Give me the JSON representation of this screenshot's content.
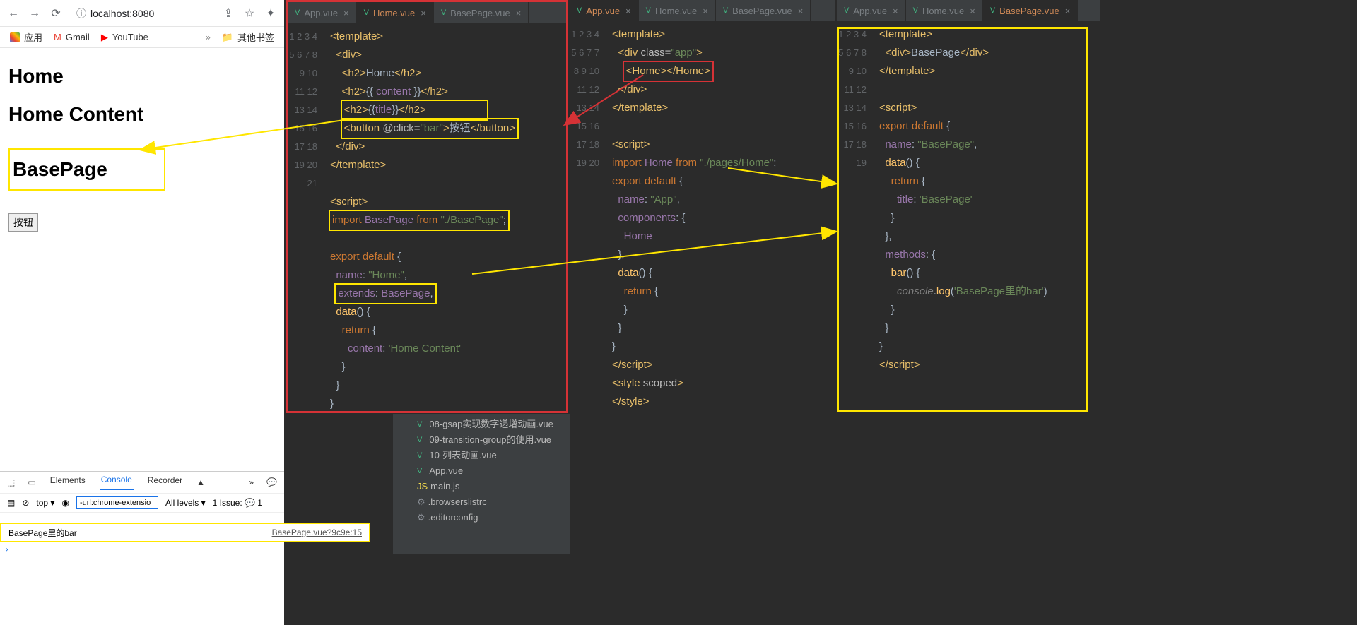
{
  "browser": {
    "url": "localhost:8080",
    "bookmarks_label": "应用",
    "gmail": "Gmail",
    "youtube": "YouTube",
    "others": "其他书签",
    "h1a": "Home",
    "h1b": "Home Content",
    "h1c": "BasePage",
    "button": "按钮"
  },
  "devtools": {
    "tabs": {
      "elements": "Elements",
      "console": "Console",
      "recorder": "Recorder"
    },
    "top": "top",
    "filter": "-url:chrome-extensio",
    "levels": "All levels",
    "issue": "1 Issue:",
    "log_msg": "BasePage里的bar",
    "log_src": "BasePage.vue?9c9e:15"
  },
  "tabs_common": {
    "app": "App.vue",
    "home": "Home.vue",
    "base": "BasePage.vue"
  },
  "editor1_lines": [
    {
      "n": 1,
      "html": "<span class='tag'>&lt;template&gt;</span>"
    },
    {
      "n": 2,
      "html": "  <span class='tag'>&lt;div&gt;</span>"
    },
    {
      "n": 3,
      "html": "    <span class='tag'>&lt;h2&gt;</span>Home<span class='tag'>&lt;/h2&gt;</span>"
    },
    {
      "n": 4,
      "html": "    <span class='tag'>&lt;h2&gt;</span>{{ <span class='id'>content</span> }}<span class='tag'>&lt;/h2&gt;</span>"
    },
    {
      "n": 5,
      "html": "    <span class='hl-yel'><span class='tag'>&lt;h2&gt;</span>{{<span class='id'>title</span>}}<span class='tag'>&lt;/h2&gt;</span>                    </span>"
    },
    {
      "n": 6,
      "html": "    <span class='hl-yel'><span class='tag'>&lt;button </span><span class='attr'>@click=</span><span class='s'>\"bar\"</span><span class='tag'>&gt;</span>按钮<span class='tag'>&lt;/button&gt;</span></span>"
    },
    {
      "n": 7,
      "html": "  <span class='tag'>&lt;/div&gt;</span>"
    },
    {
      "n": 8,
      "html": "<span class='tag'>&lt;/template&gt;</span>"
    },
    {
      "n": 9,
      "html": ""
    },
    {
      "n": 10,
      "html": "<span class='tag'>&lt;script&gt;</span>"
    },
    {
      "n": 11,
      "html": "<span class='hl-yel'><span class='k'>import</span> <span class='id'>BasePage</span> <span class='k'>from</span> <span class='s'>\"./BasePage\"</span>;</span>"
    },
    {
      "n": 12,
      "html": ""
    },
    {
      "n": 13,
      "html": "<span class='k'>export default</span> {"
    },
    {
      "n": 14,
      "html": "  <span class='id'>name</span>: <span class='s'>\"Home\"</span>,"
    },
    {
      "n": 15,
      "html": "  <span class='hl-yel'><span class='id'>extends</span>: <span class='id'>BasePage</span>,</span>"
    },
    {
      "n": 16,
      "html": "  <span class='fn'>data</span>() {"
    },
    {
      "n": 17,
      "html": "    <span class='k'>return</span> {"
    },
    {
      "n": 18,
      "html": "      <span class='id'>content</span>: <span class='s'>'Home Content'</span>"
    },
    {
      "n": 19,
      "html": "    }"
    },
    {
      "n": 20,
      "html": "  }"
    },
    {
      "n": 21,
      "html": "}"
    }
  ],
  "editor2_lines": [
    {
      "n": 1,
      "html": "<span class='tag'>&lt;template&gt;</span>"
    },
    {
      "n": 2,
      "html": "  <span class='tag'>&lt;div </span><span class='attr'>class=</span><span class='s'>\"app\"</span><span class='tag'>&gt;</span>"
    },
    {
      "n": 3,
      "html": "    <span class='hl-red'><span class='tag'>&lt;Home&gt;&lt;/Home&gt;</span></span>"
    },
    {
      "n": 4,
      "html": "  <span class='tag'>&lt;/div&gt;</span>"
    },
    {
      "n": 5,
      "html": "<span class='tag'>&lt;/template&gt;</span>"
    },
    {
      "n": 6,
      "html": ""
    },
    {
      "n": 7,
      "html": "<span class='tag'>&lt;script&gt;</span>"
    },
    {
      "n": 7.1,
      "html": "<span class='k'>import</span> <span class='id'>Home</span> <span class='k'>from</span> <span class='s'>\"./pages/Home\"</span>;"
    },
    {
      "n": 8,
      "html": "<span class='k'>export default</span> {"
    },
    {
      "n": 9,
      "html": "  <span class='id'>name</span>: <span class='s'>\"App\"</span>,"
    },
    {
      "n": 10,
      "html": "  <span class='id'>components</span>: {"
    },
    {
      "n": 11,
      "html": "    <span class='id'>Home</span>"
    },
    {
      "n": 12,
      "html": "  },"
    },
    {
      "n": 13,
      "html": "  <span class='fn'>data</span>() {"
    },
    {
      "n": 14,
      "html": "    <span class='k'>return</span> {"
    },
    {
      "n": 15,
      "html": "    }"
    },
    {
      "n": 16,
      "html": "  }"
    },
    {
      "n": 17,
      "html": "}"
    },
    {
      "n": 18,
      "html": "<span class='tag'>&lt;/script&gt;</span>"
    },
    {
      "n": 19,
      "html": "<span class='tag'>&lt;style </span><span class='attr'>scoped</span><span class='tag'>&gt;</span>"
    },
    {
      "n": 20,
      "html": "<span class='tag'>&lt;/style&gt;</span>"
    }
  ],
  "editor3_lines": [
    {
      "n": 1,
      "html": "<span class='tag'>&lt;template&gt;</span>"
    },
    {
      "n": 2,
      "html": "  <span class='tag'>&lt;div&gt;</span>BasePage<span class='tag'>&lt;/div&gt;</span>"
    },
    {
      "n": 3,
      "html": "<span class='tag'>&lt;/template&gt;</span>"
    },
    {
      "n": 4,
      "html": ""
    },
    {
      "n": 5,
      "html": "<span class='tag'>&lt;script&gt;</span>"
    },
    {
      "n": 6,
      "html": "<span class='k'>export default</span> {"
    },
    {
      "n": 7,
      "html": "  <span class='id'>name</span>: <span class='s'>\"BasePage\"</span>,"
    },
    {
      "n": 8,
      "html": "  <span class='fn'>data</span>() {"
    },
    {
      "n": 9,
      "html": "    <span class='k'>return</span> {"
    },
    {
      "n": 10,
      "html": "      <span class='id'>title</span>: <span class='s'>'BasePage'</span>"
    },
    {
      "n": 11,
      "html": "    }"
    },
    {
      "n": 12,
      "html": "  },"
    },
    {
      "n": 13,
      "html": "  <span class='id'>methods</span>: {"
    },
    {
      "n": 14,
      "html": "    <span class='fn'>bar</span>() {"
    },
    {
      "n": 15,
      "html": "      <span class='com'>console</span>.<span class='fn'>log</span>(<span class='s'>'BasePage里的bar'</span>)"
    },
    {
      "n": 16,
      "html": "    }"
    },
    {
      "n": 17,
      "html": "  }"
    },
    {
      "n": 18,
      "html": "}"
    },
    {
      "n": 19,
      "html": "<span class='tag'>&lt;/script&gt;</span>"
    }
  ],
  "filetree": [
    "08-gsap实现数字递增动画.vue",
    "09-transition-group的使用.vue",
    "10-列表动画.vue",
    "App.vue",
    "main.js",
    ".browserslistrc",
    ".editorconfig"
  ]
}
